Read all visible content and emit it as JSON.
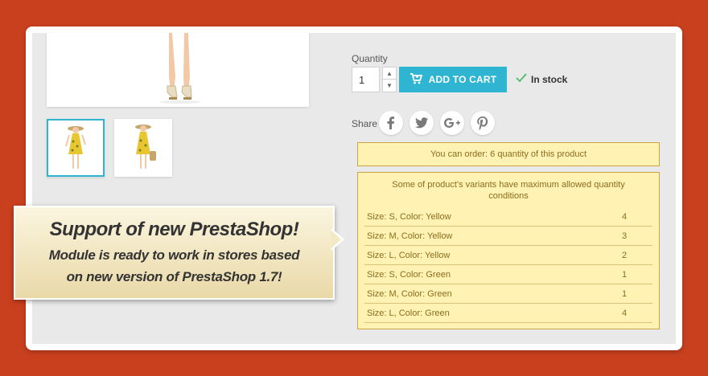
{
  "product": {
    "quantity_label": "Quantity",
    "quantity_value": "1",
    "add_to_cart_label": "ADD TO CART",
    "stock_status": "In stock",
    "share_label": "Share",
    "share_icons": [
      "facebook-icon",
      "twitter-icon",
      "google-plus-icon",
      "pinterest-icon"
    ],
    "accent_color": "#2fb5d2"
  },
  "notice": {
    "order_text": "You can order: 6 quantity of this product"
  },
  "variants": {
    "title": "Some of product's variants have maximum allowed quantity conditions",
    "rows": [
      {
        "name": "Size: S, Color: Yellow",
        "qty": "4"
      },
      {
        "name": "Size: M, Color: Yellow",
        "qty": "3"
      },
      {
        "name": "Size: L, Color: Yellow",
        "qty": "2"
      },
      {
        "name": "Size: S, Color: Green",
        "qty": "1"
      },
      {
        "name": "Size: M, Color: Green",
        "qty": "1"
      },
      {
        "name": "Size: L, Color: Green",
        "qty": "4"
      }
    ]
  },
  "banner": {
    "title": "Support of new PrestaShop!",
    "line1": "Module is ready to work in stores based",
    "line2": "on new version of PrestaShop 1.7!"
  },
  "colors": {
    "background": "#c9401f",
    "notice_bg": "#fff2b3",
    "notice_text": "#8a6d1f"
  }
}
